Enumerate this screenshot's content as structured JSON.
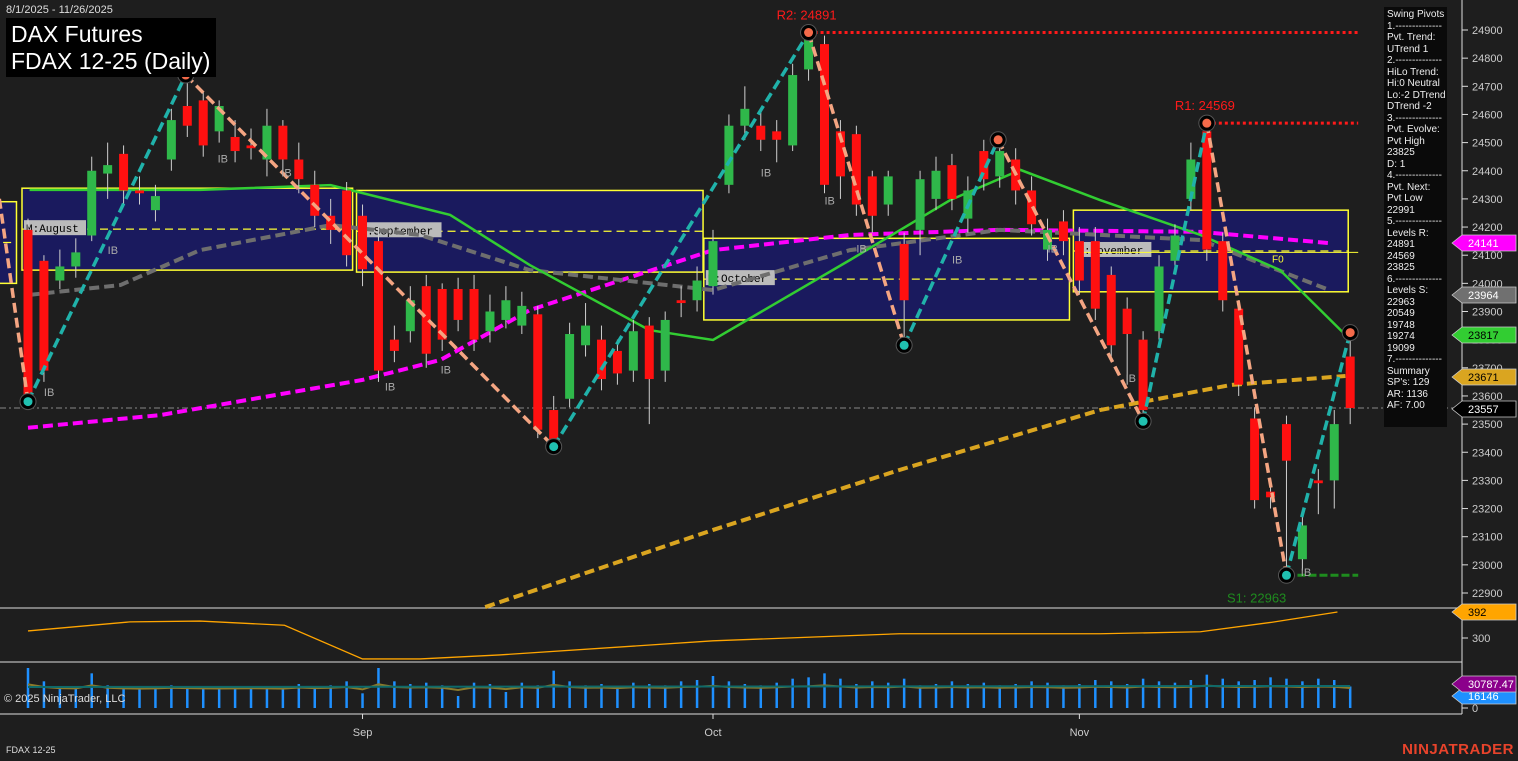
{
  "header": {
    "date_range": "8/1/2025 - 11/26/2025",
    "title": "DAX Futures",
    "subtitle": "FDAX 12-25 (Daily)"
  },
  "footer": {
    "copyright": "© 2025 NinjaTrader, LLC",
    "instrument": "FDAX 12-25",
    "logo": "NINJATRADER"
  },
  "info_panel": {
    "lines": [
      "Swing Pivots",
      "1.--------------",
      "Pvt. Trend:",
      "UTrend 1",
      "2.--------------",
      "HiLo Trend:",
      "Hi:0 Neutral",
      "Lo:-2 DTrend",
      "DTrend -2",
      "3.--------------",
      "Pvt. Evolve:",
      "Pvt High",
      "23825",
      "D: 1",
      "4.--------------",
      "Pvt. Next:",
      "Pvt Low",
      "22991",
      "5.--------------",
      "Levels R:",
      "24891",
      "24569",
      "23825",
      "6.--------------",
      "Levels S:",
      "22963",
      "20549",
      "19748",
      "19274",
      "19099",
      "7.--------------",
      "Summary",
      "SP's: 129",
      "AR: 1136",
      "AF: 7.00"
    ]
  },
  "chart_data": {
    "type": "candlestick",
    "title": "DAX Futures FDAX 12-25 (Daily)",
    "x_tick_labels": [
      {
        "bar": 22,
        "label": "Sep"
      },
      {
        "bar": 44,
        "label": "Oct"
      },
      {
        "bar": 67,
        "label": "Nov"
      }
    ],
    "ylim": [
      22850,
      24990
    ],
    "y_ticks": [
      22900,
      23000,
      23100,
      23200,
      23300,
      23400,
      23500,
      23600,
      23700,
      23800,
      23900,
      24000,
      24100,
      24200,
      24300,
      24400,
      24500,
      24600,
      24700,
      24800,
      24900
    ],
    "ohlc": [
      [
        24190,
        24230,
        23580,
        23590
      ],
      [
        24080,
        24100,
        23650,
        23690
      ],
      [
        24010,
        24120,
        23980,
        24060
      ],
      [
        24060,
        24160,
        24020,
        24110
      ],
      [
        24170,
        24450,
        24150,
        24400
      ],
      [
        24390,
        24500,
        24300,
        24420
      ],
      [
        24460,
        24490,
        24280,
        24330
      ],
      [
        24330,
        24380,
        24280,
        24320
      ],
      [
        24260,
        24350,
        24220,
        24310
      ],
      [
        24440,
        24620,
        24400,
        24580
      ],
      [
        24630,
        24740,
        24520,
        24560
      ],
      [
        24650,
        24680,
        24450,
        24490
      ],
      [
        24540,
        24650,
        24500,
        24630
      ],
      [
        24520,
        24580,
        24430,
        24470
      ],
      [
        24490,
        24550,
        24440,
        24480
      ],
      [
        24440,
        24620,
        24380,
        24560
      ],
      [
        24560,
        24580,
        24400,
        24440
      ],
      [
        24440,
        24500,
        24320,
        24370
      ],
      [
        24350,
        24400,
        24200,
        24240
      ],
      [
        24240,
        24300,
        24140,
        24190
      ],
      [
        24330,
        24360,
        24060,
        24100
      ],
      [
        24240,
        24280,
        23990,
        24050
      ],
      [
        24150,
        24200,
        23650,
        23690
      ],
      [
        23800,
        23850,
        23720,
        23760
      ],
      [
        23830,
        23990,
        23790,
        23940
      ],
      [
        23990,
        24030,
        23700,
        23750
      ],
      [
        23980,
        24000,
        23760,
        23800
      ],
      [
        23980,
        24020,
        23830,
        23870
      ],
      [
        23980,
        24030,
        23760,
        23800
      ],
      [
        23830,
        23960,
        23790,
        23900
      ],
      [
        23870,
        23990,
        23840,
        23940
      ],
      [
        23850,
        23970,
        23820,
        23920
      ],
      [
        23890,
        23920,
        23450,
        23480
      ],
      [
        23550,
        23600,
        23420,
        23440
      ],
      [
        23590,
        23860,
        23560,
        23820
      ],
      [
        23780,
        23930,
        23740,
        23850
      ],
      [
        23800,
        23850,
        23620,
        23660
      ],
      [
        23760,
        23800,
        23640,
        23680
      ],
      [
        23690,
        23870,
        23650,
        23830
      ],
      [
        23850,
        23880,
        23500,
        23660
      ],
      [
        23690,
        23900,
        23650,
        23870
      ],
      [
        23940,
        23990,
        23880,
        23930
      ],
      [
        23940,
        24060,
        23900,
        24010
      ],
      [
        23990,
        24190,
        23960,
        24150
      ],
      [
        24350,
        24600,
        24320,
        24560
      ],
      [
        24560,
        24700,
        24510,
        24620
      ],
      [
        24560,
        24620,
        24470,
        24510
      ],
      [
        24540,
        24580,
        24430,
        24510
      ],
      [
        24490,
        24780,
        24470,
        24740
      ],
      [
        24760,
        24891,
        24720,
        24880
      ],
      [
        24850,
        24880,
        24320,
        24350
      ],
      [
        24540,
        24580,
        24300,
        24380
      ],
      [
        24530,
        24560,
        24240,
        24280
      ],
      [
        24380,
        24400,
        24180,
        24240
      ],
      [
        24280,
        24400,
        24240,
        24380
      ],
      [
        24140,
        24180,
        23780,
        23940
      ],
      [
        24190,
        24400,
        24100,
        24370
      ],
      [
        24300,
        24450,
        24260,
        24400
      ],
      [
        24420,
        24460,
        24260,
        24300
      ],
      [
        24230,
        24380,
        24180,
        24330
      ],
      [
        24470,
        24510,
        24330,
        24370
      ],
      [
        24380,
        24500,
        24340,
        24470
      ],
      [
        24440,
        24480,
        24280,
        24330
      ],
      [
        24330,
        24380,
        24170,
        24210
      ],
      [
        24120,
        24230,
        24080,
        24190
      ],
      [
        24220,
        24260,
        24100,
        24150
      ],
      [
        24150,
        24200,
        23960,
        24010
      ],
      [
        24150,
        24200,
        23870,
        23910
      ],
      [
        24030,
        24060,
        23740,
        23780
      ],
      [
        23910,
        23950,
        23640,
        23820
      ],
      [
        23800,
        23830,
        23510,
        23550
      ],
      [
        23830,
        24100,
        23800,
        24060
      ],
      [
        24080,
        24210,
        24040,
        24170
      ],
      [
        24300,
        24500,
        24260,
        24440
      ],
      [
        24540,
        24569,
        24080,
        24120
      ],
      [
        24150,
        24180,
        23900,
        23940
      ],
      [
        23910,
        23940,
        23600,
        23640
      ],
      [
        23520,
        23560,
        23200,
        23230
      ],
      [
        23260,
        23300,
        23200,
        23240
      ],
      [
        23500,
        23530,
        22963,
        23370
      ],
      [
        23020,
        23180,
        22980,
        23140
      ],
      [
        23300,
        23340,
        23180,
        23290
      ],
      [
        23300,
        23550,
        23200,
        23500
      ],
      [
        23740,
        23825,
        23500,
        23557
      ]
    ],
    "moving_averages": [
      {
        "name": "magenta",
        "color": "#ff00ff",
        "dash": true,
        "last": "24141",
        "points": [
          [
            1,
            23487
          ],
          [
            9.3,
            23532
          ],
          [
            22,
            23657
          ],
          [
            26.9,
            23728
          ],
          [
            32.5,
            23905
          ],
          [
            44,
            24118
          ],
          [
            52.6,
            24172
          ],
          [
            62,
            24190
          ],
          [
            74.6,
            24183
          ],
          [
            82.7,
            24143
          ]
        ]
      },
      {
        "name": "gray",
        "color": "#6e6e6e",
        "dash": true,
        "last": "23964",
        "points": [
          [
            1.1,
            23959
          ],
          [
            6.8,
            23994
          ],
          [
            11.8,
            24118
          ],
          [
            20,
            24207
          ],
          [
            25.6,
            24172
          ],
          [
            32.5,
            24047
          ],
          [
            44,
            23976
          ],
          [
            52.6,
            24118
          ],
          [
            62,
            24190
          ],
          [
            74.6,
            24154
          ],
          [
            82.7,
            23976
          ]
        ]
      },
      {
        "name": "green",
        "color": "#32cd32",
        "dash": false,
        "last": "23817",
        "points": [
          [
            1.1,
            24332
          ],
          [
            11.8,
            24332
          ],
          [
            20,
            24349
          ],
          [
            27.5,
            24243
          ],
          [
            32.5,
            24065
          ],
          [
            40,
            23834
          ],
          [
            44,
            23799
          ],
          [
            52.6,
            24083
          ],
          [
            58.9,
            24296
          ],
          [
            63.3,
            24403
          ],
          [
            68.3,
            24296
          ],
          [
            74.6,
            24172
          ],
          [
            79.6,
            24047
          ],
          [
            83.7,
            23817
          ]
        ]
      },
      {
        "name": "gold",
        "color": "#daa520",
        "dash": true,
        "last": "23671",
        "points": [
          [
            29.7,
            22850
          ],
          [
            44,
            23124
          ],
          [
            55.7,
            23337
          ],
          [
            68.3,
            23550
          ],
          [
            76.5,
            23639
          ],
          [
            83.7,
            23671
          ]
        ]
      }
    ],
    "last_price": "23557",
    "swing_pivots": [
      [
        -0.8,
        24300
      ],
      [
        1,
        23580
      ],
      [
        10.9,
        24740
      ],
      [
        34,
        23420
      ],
      [
        50,
        24891
      ],
      [
        56,
        23780
      ],
      [
        61.9,
        24510
      ],
      [
        71,
        23510
      ],
      [
        75,
        24569
      ],
      [
        80,
        22963
      ],
      [
        84,
        23825
      ]
    ],
    "levels": [
      {
        "label": "R2: 24891",
        "price": 24891,
        "from": 50,
        "color": "#ff1a1a"
      },
      {
        "label": "R1: 24569",
        "price": 24569,
        "from": 75,
        "color": "#ff1a1a"
      },
      {
        "label": "S1: 22963",
        "price": 22963,
        "from": 80,
        "color": "#1e8c1e"
      }
    ],
    "monthly_boxes": [
      {
        "label": "",
        "from": -1,
        "to": -0.1,
        "high": 24290,
        "low": 24000
      },
      {
        "label": "M:August",
        "from": 1,
        "to": 21,
        "high": 24338,
        "low": 24047
      },
      {
        "label": "M:September",
        "from": 22,
        "to": 43,
        "high": 24330,
        "low": 24040
      },
      {
        "label": "M:October",
        "from": 43.8,
        "to": 66,
        "high": 24160,
        "low": 23870
      },
      {
        "label": "M:November",
        "from": 67,
        "to": 83.5,
        "high": 24260,
        "low": 23970
      }
    ],
    "f0_label": "F0",
    "f0_price": 24110,
    "ib_labels": [
      [
        2,
        23600
      ],
      [
        6,
        24104
      ],
      [
        12.9,
        24430
      ],
      [
        16.9,
        24380
      ],
      [
        23.4,
        23620
      ],
      [
        26.9,
        23680
      ],
      [
        47,
        24380
      ],
      [
        51,
        24280
      ],
      [
        53,
        24110
      ],
      [
        59,
        24070
      ],
      [
        65,
        24110
      ],
      [
        69.9,
        23650
      ],
      [
        80.9,
        22960
      ]
    ],
    "indicator": {
      "label": "392",
      "tick": "300",
      "color": "#ffa500",
      "points": [
        [
          1,
          325
        ],
        [
          7.4,
          357
        ],
        [
          11.8,
          360
        ],
        [
          17.1,
          345
        ],
        [
          22,
          226
        ],
        [
          25.6,
          226
        ],
        [
          30.6,
          240
        ],
        [
          44,
          290
        ],
        [
          55.7,
          315
        ],
        [
          68.3,
          315
        ],
        [
          74.6,
          322
        ],
        [
          79,
          355
        ],
        [
          83.2,
          392
        ]
      ]
    },
    "volume": {
      "label_total": "30787.47",
      "label_last": "16146",
      "zero_tick": "0",
      "values": [
        30000,
        20000,
        16000,
        15000,
        26000,
        17000,
        15000,
        14000,
        15000,
        17000,
        16000,
        15000,
        14500,
        15000,
        15500,
        15000,
        14000,
        18000,
        16000,
        17000,
        20000,
        11000,
        30000,
        20000,
        18000,
        19000,
        17000,
        9000,
        19000,
        18000,
        12000,
        19000,
        17000,
        28000,
        20000,
        17000,
        18000,
        16000,
        19000,
        18000,
        17000,
        20000,
        21000,
        24000,
        20000,
        18000,
        17000,
        19000,
        22000,
        23000,
        26000,
        22000,
        18000,
        20000,
        19000,
        22000,
        17000,
        18000,
        20000,
        18000,
        19000,
        17000,
        18000,
        20000,
        19000,
        17000,
        18000,
        21000,
        20000,
        18000,
        22000,
        20000,
        19000,
        21000,
        25000,
        22000,
        20000,
        21000,
        23000,
        22000,
        20000,
        22000,
        21000,
        16146
      ]
    }
  }
}
